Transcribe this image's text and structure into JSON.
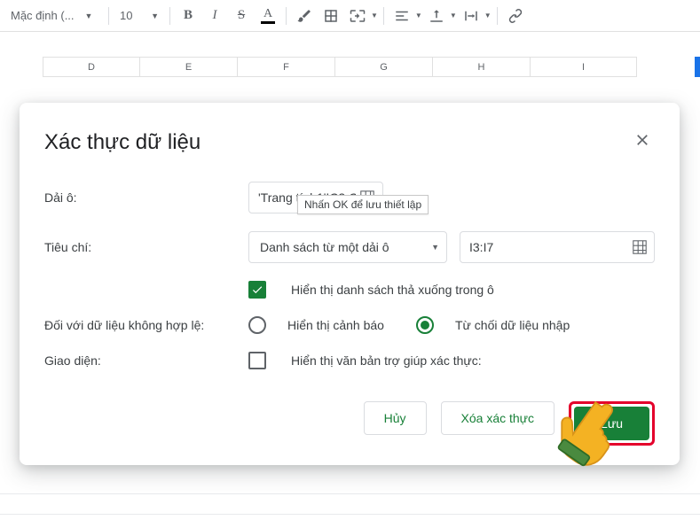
{
  "toolbar": {
    "font_name": "Mặc định (...",
    "font_size": "10"
  },
  "columns": [
    "D",
    "E",
    "F",
    "G",
    "H",
    "I"
  ],
  "dialog": {
    "title": "Xác thực dữ liệu",
    "tooltip": "Nhấn OK để lưu thiết lập",
    "cell_range": {
      "label": "Dải ô:",
      "value": "'Trang tính1'!C2:C"
    },
    "criteria": {
      "label": "Tiêu chí:",
      "type": "Danh sách từ một dải ô",
      "range": "I3:I7"
    },
    "show_dropdown_label": "Hiển thị danh sách thả xuống trong ô",
    "show_dropdown_checked": true,
    "invalid": {
      "label": "Đối với dữ liệu không hợp lệ:",
      "warning": "Hiển thị cảnh báo",
      "reject": "Từ chối dữ liệu nhập",
      "selected": "reject"
    },
    "appearance": {
      "label": "Giao diện:",
      "help_text_label": "Hiển thị văn bản trợ giúp xác thực:",
      "checked": false
    },
    "buttons": {
      "cancel": "Hủy",
      "remove": "Xóa xác thực",
      "save": "Lưu"
    }
  }
}
